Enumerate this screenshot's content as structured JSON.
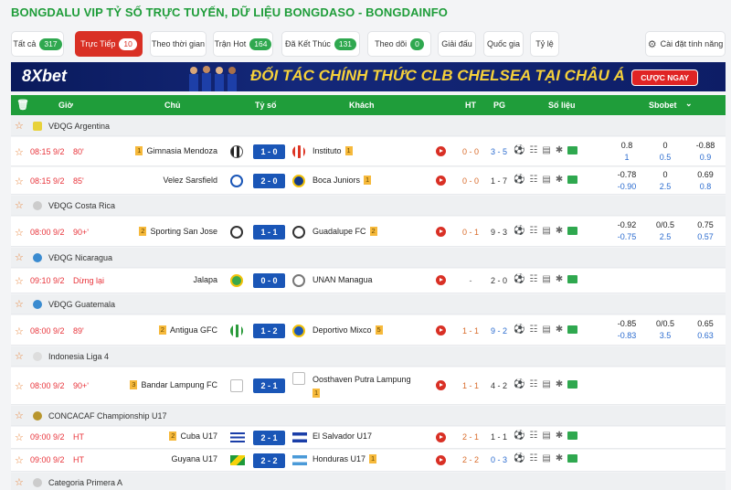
{
  "page_title": "BONGDALU VIP TỶ SỐ TRỰC TUYẾN, DỮ LIỆU BONGDASO - BONGDAINFO",
  "filters": [
    {
      "label": "Tất cả",
      "count": "317"
    },
    {
      "label": "Trực Tiếp",
      "count": "10"
    },
    {
      "label": "Theo thời gian",
      "count": ""
    },
    {
      "label": "Trận Hot",
      "count": "164"
    },
    {
      "label": "Đã Kết Thúc",
      "count": "131"
    },
    {
      "label": "Theo dõi",
      "count": "0"
    },
    {
      "label": "Giải đấu",
      "count": ""
    },
    {
      "label": "Quốc gia",
      "count": ""
    },
    {
      "label": "Tỷ lệ",
      "count": ""
    },
    {
      "label": "Cài đặt tính năng",
      "count": ""
    }
  ],
  "banner": {
    "logo": "8Xbet",
    "text": "ĐỐI TÁC CHÍNH THỨC CLB CHELSEA TẠI CHÂU Á",
    "cta": "CƯỢC NGAY"
  },
  "header": {
    "time": "Giờ",
    "home": "Chủ",
    "score": "Tỷ số",
    "away": "Khách",
    "ht": "HT",
    "pg": "PG",
    "data": "Số liệu",
    "sbobet": "Sbobet"
  },
  "leagues": [
    {
      "name": "VĐQG Argentina"
    },
    {
      "name": "VĐQG Costa Rica"
    },
    {
      "name": "VĐQG Nicaragua"
    },
    {
      "name": "VĐQG Guatemala"
    },
    {
      "name": "Indonesia Liga 4"
    },
    {
      "name": "CONCACAF Championship U17"
    },
    {
      "name": "Categoria Primera A"
    }
  ],
  "matches": [
    {
      "time": "08:15 9/2",
      "min": "80'",
      "home": "Gimnasia Mendoza",
      "home_rc": "1",
      "score": "1 - 0",
      "away": "Instituto",
      "away_rc": "1",
      "ht": "0 - 0",
      "pg": "3 - 5",
      "pg_blue": true,
      "o1": "0.8",
      "o2": "0",
      "o3": "-0.88",
      "o4": "1",
      "o5": "0.5",
      "o6": "0.9"
    },
    {
      "time": "08:15 9/2",
      "min": "85'",
      "home": "Velez Sarsfield",
      "home_rc": "",
      "score": "2 - 0",
      "away": "Boca Juniors",
      "away_rc": "1",
      "ht": "0 - 0",
      "pg": "1 - 7",
      "pg_blue": false,
      "o1": "-0.78",
      "o2": "0",
      "o3": "0.69",
      "o4": "-0.90",
      "o5": "2.5",
      "o6": "0.8"
    },
    {
      "time": "08:00 9/2",
      "min": "90+'",
      "home": "Sporting San Jose",
      "home_rc": "2",
      "score": "1 - 1",
      "away": "Guadalupe FC",
      "away_rc": "2",
      "ht": "0 - 1",
      "pg": "9 - 3",
      "pg_blue": false,
      "o1": "-0.92",
      "o2": "0/0.5",
      "o3": "0.75",
      "o4": "-0.75",
      "o5": "2.5",
      "o6": "0.57"
    },
    {
      "time": "09:10 9/2",
      "min": "Dừng lại",
      "home": "Jalapa",
      "home_rc": "",
      "score": "0 - 0",
      "away": "UNAN Managua",
      "away_rc": "",
      "ht": "-",
      "pg": "2 - 0",
      "pg_blue": false,
      "o1": "",
      "o2": "",
      "o3": "",
      "o4": "",
      "o5": "",
      "o6": ""
    },
    {
      "time": "08:00 9/2",
      "min": "89'",
      "home": "Antigua GFC",
      "home_rc": "2",
      "score": "1 - 2",
      "away": "Deportivo Mixco",
      "away_rc": "5",
      "ht": "1 - 1",
      "pg": "9 - 2",
      "pg_blue": true,
      "o1": "-0.85",
      "o2": "0/0.5",
      "o3": "0.65",
      "o4": "-0.83",
      "o5": "3.5",
      "o6": "0.63"
    },
    {
      "time": "08:00 9/2",
      "min": "90+'",
      "home": "Bandar Lampung FC",
      "home_rc": "3",
      "score": "2 - 1",
      "away": "Oosthaven Putra Lampung",
      "away_rc": "1",
      "ht": "1 - 1",
      "pg": "4 - 2",
      "pg_blue": false,
      "o1": "",
      "o2": "",
      "o3": "",
      "o4": "",
      "o5": "",
      "o6": ""
    },
    {
      "time": "09:00 9/2",
      "min": "HT",
      "home": "Cuba U17",
      "home_rc": "2",
      "score": "2 - 1",
      "away": "El Salvador U17",
      "away_rc": "",
      "ht": "2 - 1",
      "pg": "1 - 1",
      "pg_blue": false,
      "o1": "",
      "o2": "",
      "o3": "",
      "o4": "",
      "o5": "",
      "o6": ""
    },
    {
      "time": "09:00 9/2",
      "min": "HT",
      "home": "Guyana U17",
      "home_rc": "",
      "score": "2 - 2",
      "away": "Honduras U17",
      "away_rc": "1",
      "ht": "2 - 2",
      "pg": "0 - 3",
      "pg_blue": true,
      "o1": "",
      "o2": "",
      "o3": "",
      "o4": "",
      "o5": "",
      "o6": ""
    }
  ],
  "colors": {
    "brand_green": "#1f9d3a",
    "live_red": "#d93025",
    "score_blue": "#1a56b7"
  }
}
